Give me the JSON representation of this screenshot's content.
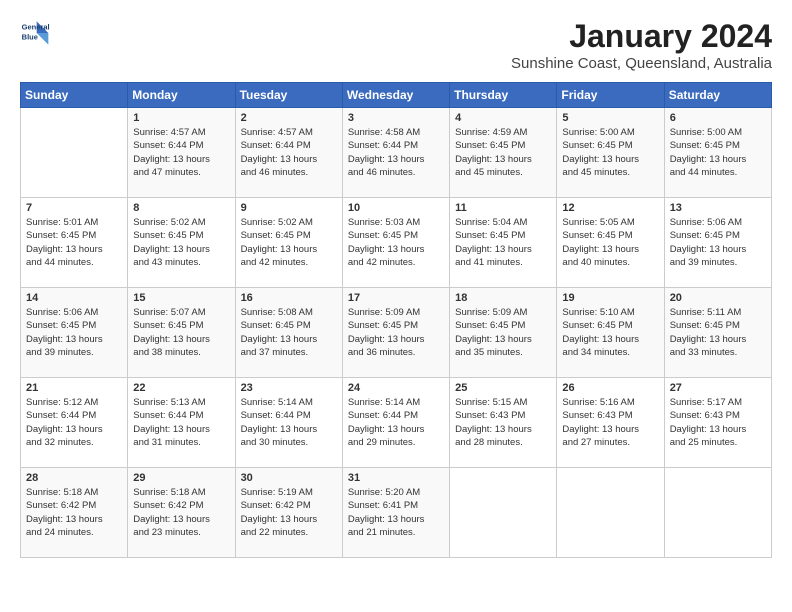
{
  "logo": {
    "line1": "General",
    "line2": "Blue"
  },
  "title": "January 2024",
  "subtitle": "Sunshine Coast, Queensland, Australia",
  "days_of_week": [
    "Sunday",
    "Monday",
    "Tuesday",
    "Wednesday",
    "Thursday",
    "Friday",
    "Saturday"
  ],
  "weeks": [
    [
      {
        "day": "",
        "info": ""
      },
      {
        "day": "1",
        "info": "Sunrise: 4:57 AM\nSunset: 6:44 PM\nDaylight: 13 hours\nand 47 minutes."
      },
      {
        "day": "2",
        "info": "Sunrise: 4:57 AM\nSunset: 6:44 PM\nDaylight: 13 hours\nand 46 minutes."
      },
      {
        "day": "3",
        "info": "Sunrise: 4:58 AM\nSunset: 6:44 PM\nDaylight: 13 hours\nand 46 minutes."
      },
      {
        "day": "4",
        "info": "Sunrise: 4:59 AM\nSunset: 6:45 PM\nDaylight: 13 hours\nand 45 minutes."
      },
      {
        "day": "5",
        "info": "Sunrise: 5:00 AM\nSunset: 6:45 PM\nDaylight: 13 hours\nand 45 minutes."
      },
      {
        "day": "6",
        "info": "Sunrise: 5:00 AM\nSunset: 6:45 PM\nDaylight: 13 hours\nand 44 minutes."
      }
    ],
    [
      {
        "day": "7",
        "info": "Sunrise: 5:01 AM\nSunset: 6:45 PM\nDaylight: 13 hours\nand 44 minutes."
      },
      {
        "day": "8",
        "info": "Sunrise: 5:02 AM\nSunset: 6:45 PM\nDaylight: 13 hours\nand 43 minutes."
      },
      {
        "day": "9",
        "info": "Sunrise: 5:02 AM\nSunset: 6:45 PM\nDaylight: 13 hours\nand 42 minutes."
      },
      {
        "day": "10",
        "info": "Sunrise: 5:03 AM\nSunset: 6:45 PM\nDaylight: 13 hours\nand 42 minutes."
      },
      {
        "day": "11",
        "info": "Sunrise: 5:04 AM\nSunset: 6:45 PM\nDaylight: 13 hours\nand 41 minutes."
      },
      {
        "day": "12",
        "info": "Sunrise: 5:05 AM\nSunset: 6:45 PM\nDaylight: 13 hours\nand 40 minutes."
      },
      {
        "day": "13",
        "info": "Sunrise: 5:06 AM\nSunset: 6:45 PM\nDaylight: 13 hours\nand 39 minutes."
      }
    ],
    [
      {
        "day": "14",
        "info": "Sunrise: 5:06 AM\nSunset: 6:45 PM\nDaylight: 13 hours\nand 39 minutes."
      },
      {
        "day": "15",
        "info": "Sunrise: 5:07 AM\nSunset: 6:45 PM\nDaylight: 13 hours\nand 38 minutes."
      },
      {
        "day": "16",
        "info": "Sunrise: 5:08 AM\nSunset: 6:45 PM\nDaylight: 13 hours\nand 37 minutes."
      },
      {
        "day": "17",
        "info": "Sunrise: 5:09 AM\nSunset: 6:45 PM\nDaylight: 13 hours\nand 36 minutes."
      },
      {
        "day": "18",
        "info": "Sunrise: 5:09 AM\nSunset: 6:45 PM\nDaylight: 13 hours\nand 35 minutes."
      },
      {
        "day": "19",
        "info": "Sunrise: 5:10 AM\nSunset: 6:45 PM\nDaylight: 13 hours\nand 34 minutes."
      },
      {
        "day": "20",
        "info": "Sunrise: 5:11 AM\nSunset: 6:45 PM\nDaylight: 13 hours\nand 33 minutes."
      }
    ],
    [
      {
        "day": "21",
        "info": "Sunrise: 5:12 AM\nSunset: 6:44 PM\nDaylight: 13 hours\nand 32 minutes."
      },
      {
        "day": "22",
        "info": "Sunrise: 5:13 AM\nSunset: 6:44 PM\nDaylight: 13 hours\nand 31 minutes."
      },
      {
        "day": "23",
        "info": "Sunrise: 5:14 AM\nSunset: 6:44 PM\nDaylight: 13 hours\nand 30 minutes."
      },
      {
        "day": "24",
        "info": "Sunrise: 5:14 AM\nSunset: 6:44 PM\nDaylight: 13 hours\nand 29 minutes."
      },
      {
        "day": "25",
        "info": "Sunrise: 5:15 AM\nSunset: 6:43 PM\nDaylight: 13 hours\nand 28 minutes."
      },
      {
        "day": "26",
        "info": "Sunrise: 5:16 AM\nSunset: 6:43 PM\nDaylight: 13 hours\nand 27 minutes."
      },
      {
        "day": "27",
        "info": "Sunrise: 5:17 AM\nSunset: 6:43 PM\nDaylight: 13 hours\nand 25 minutes."
      }
    ],
    [
      {
        "day": "28",
        "info": "Sunrise: 5:18 AM\nSunset: 6:42 PM\nDaylight: 13 hours\nand 24 minutes."
      },
      {
        "day": "29",
        "info": "Sunrise: 5:18 AM\nSunset: 6:42 PM\nDaylight: 13 hours\nand 23 minutes."
      },
      {
        "day": "30",
        "info": "Sunrise: 5:19 AM\nSunset: 6:42 PM\nDaylight: 13 hours\nand 22 minutes."
      },
      {
        "day": "31",
        "info": "Sunrise: 5:20 AM\nSunset: 6:41 PM\nDaylight: 13 hours\nand 21 minutes."
      },
      {
        "day": "",
        "info": ""
      },
      {
        "day": "",
        "info": ""
      },
      {
        "day": "",
        "info": ""
      }
    ]
  ]
}
